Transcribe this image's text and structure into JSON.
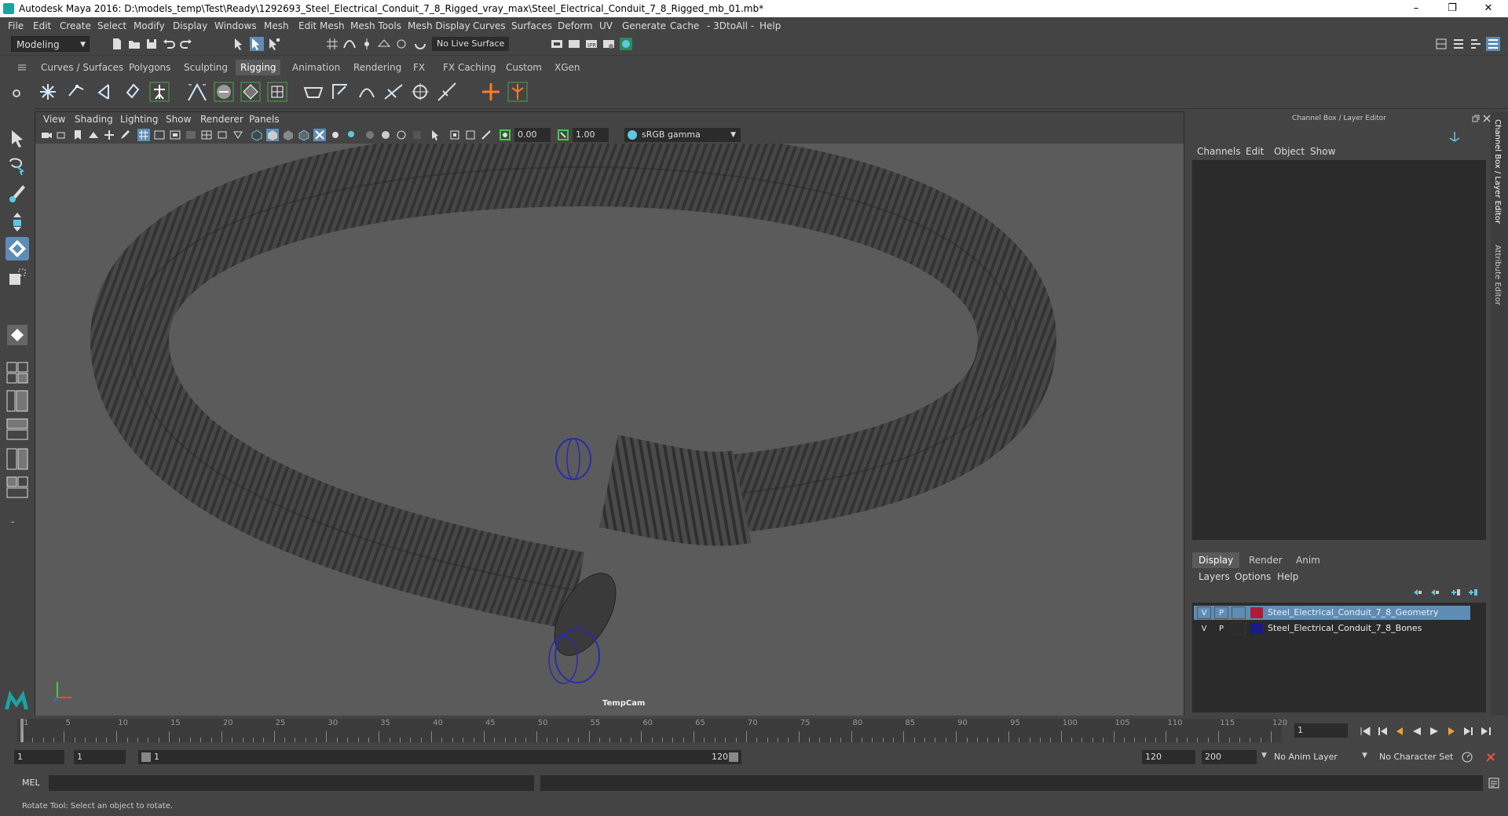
{
  "window": {
    "title": "Autodesk Maya 2016: D:\\models_temp\\Test\\Ready\\1292693_Steel_Electrical_Conduit_7_8_Rigged_vray_max\\Steel_Electrical_Conduit_7_8_Rigged_mb_01.mb*",
    "minimize": "–",
    "maximize": "❐",
    "close": "✕"
  },
  "menubar": [
    "File",
    "Edit",
    "Create",
    "Select",
    "Modify",
    "Display",
    "Windows",
    "Mesh",
    "Edit Mesh",
    "Mesh Tools",
    "Mesh Display",
    "Curves",
    "Surfaces",
    "Deform",
    "UV",
    "Generate",
    "Cache",
    "- 3DtoAll -",
    "Help"
  ],
  "statusline": {
    "mode": "Modeling",
    "live_surface": "No Live Surface"
  },
  "shelf_tabs": [
    "Curves / Surfaces",
    "Polygons",
    "Sculpting",
    "Rigging",
    "Animation",
    "Rendering",
    "FX",
    "FX Caching",
    "Custom",
    "XGen"
  ],
  "active_shelf_tab": "Rigging",
  "panel_menu": [
    "View",
    "Shading",
    "Lighting",
    "Show",
    "Renderer",
    "Panels"
  ],
  "panel_tools": {
    "exposure": "0.00",
    "gamma_value": "1.00",
    "color_space": "sRGB gamma"
  },
  "viewport": {
    "camera": "TempCam"
  },
  "channel_box": {
    "title": "Channel Box / Layer Editor",
    "menu": [
      "Channels",
      "Edit",
      "Object",
      "Show"
    ]
  },
  "layer_editor": {
    "tabs": [
      "Display",
      "Render",
      "Anim"
    ],
    "active_tab": "Display",
    "menu": [
      "Layers",
      "Options",
      "Help"
    ],
    "layers": [
      {
        "v": "V",
        "p": "P",
        "color": "#b01a3a",
        "name": "Steel_Electrical_Conduit_7_8_Geometry",
        "selected": true
      },
      {
        "v": "V",
        "p": "P",
        "color": "#1a1a8a",
        "name": "Steel_Electrical_Conduit_7_8_Bones",
        "selected": false
      }
    ]
  },
  "side_tabs": [
    "Channel Box / Layer Editor",
    "Attribute Editor"
  ],
  "timeline": {
    "ticks": [
      "1",
      "5",
      "10",
      "15",
      "20",
      "25",
      "30",
      "35",
      "40",
      "45",
      "50",
      "55",
      "60",
      "65",
      "70",
      "75",
      "80",
      "85",
      "90",
      "95",
      "100",
      "105",
      "110",
      "115",
      "120"
    ],
    "current_frame": "1"
  },
  "range": {
    "start": "1",
    "playback_start": "1",
    "slider_start": "1",
    "slider_end": "120",
    "playback_end": "120",
    "end": "200",
    "anim_layer": "No Anim Layer",
    "character_set": "No Character Set"
  },
  "command_line": {
    "label": "MEL"
  },
  "help_line": "Rotate Tool: Select an object to rotate."
}
